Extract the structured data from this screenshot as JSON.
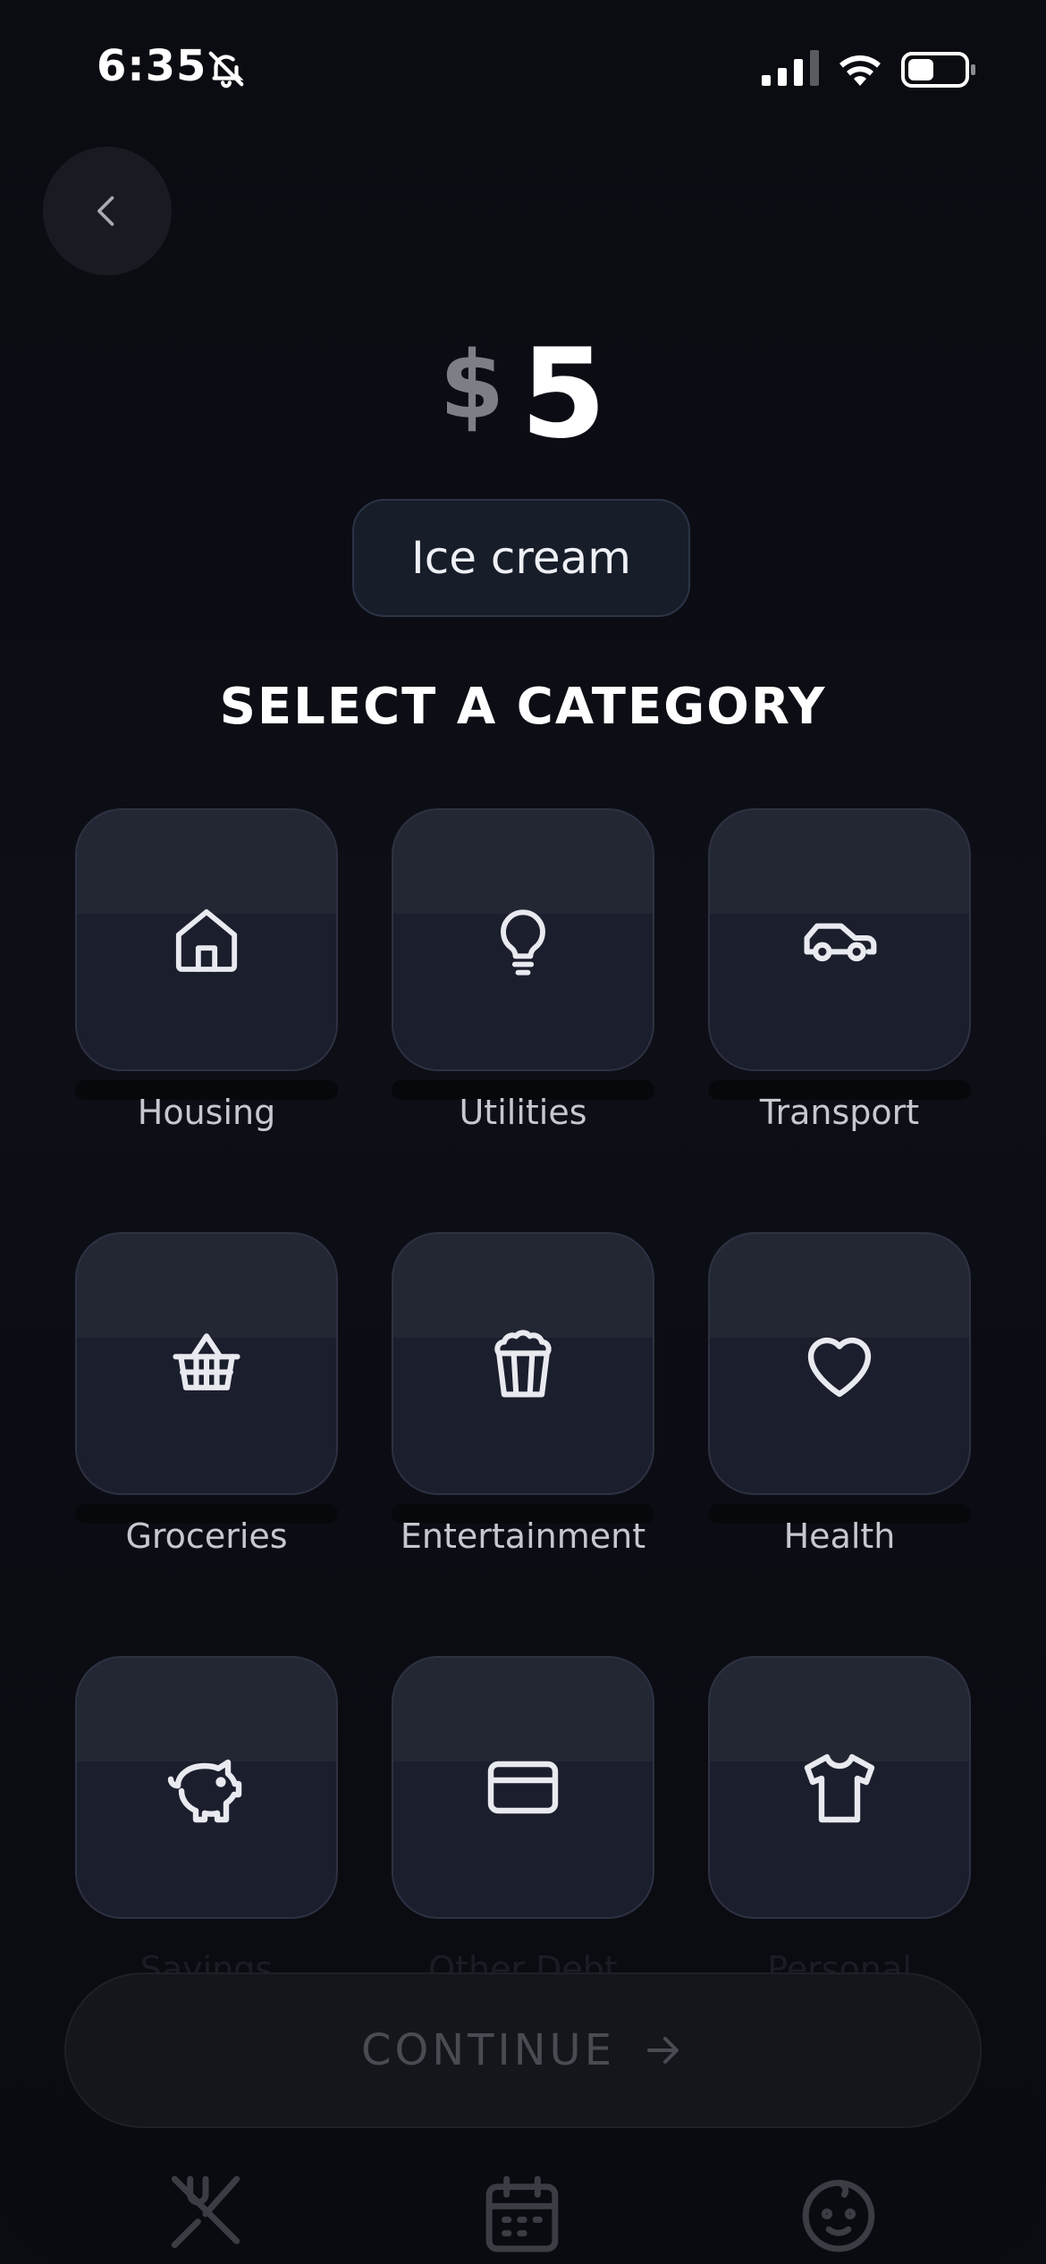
{
  "status": {
    "time": "6:35"
  },
  "amount": {
    "currency": "$",
    "value": "5"
  },
  "description": "Ice cream",
  "section_title": "SELECT A CATEGORY",
  "categories": [
    {
      "label": "Housing",
      "icon": "house-icon"
    },
    {
      "label": "Utilities",
      "icon": "lightbulb-icon"
    },
    {
      "label": "Transport",
      "icon": "car-icon"
    },
    {
      "label": "Groceries",
      "icon": "basket-icon"
    },
    {
      "label": "Entertainment",
      "icon": "popcorn-icon"
    },
    {
      "label": "Health",
      "icon": "heart-icon"
    },
    {
      "label": "Savings",
      "icon": "piggy-bank-icon"
    },
    {
      "label": "Other Debt",
      "icon": "credit-card-icon"
    },
    {
      "label": "Personal",
      "icon": "tshirt-icon"
    }
  ],
  "continue_button": {
    "label": "CONTINUE"
  },
  "tabs": [
    "food-icon",
    "calendar-icon",
    "baby-face-icon"
  ],
  "colors": {
    "background": "#0b0c12",
    "tile": "#1b1e2d",
    "pill": "#171d29"
  }
}
